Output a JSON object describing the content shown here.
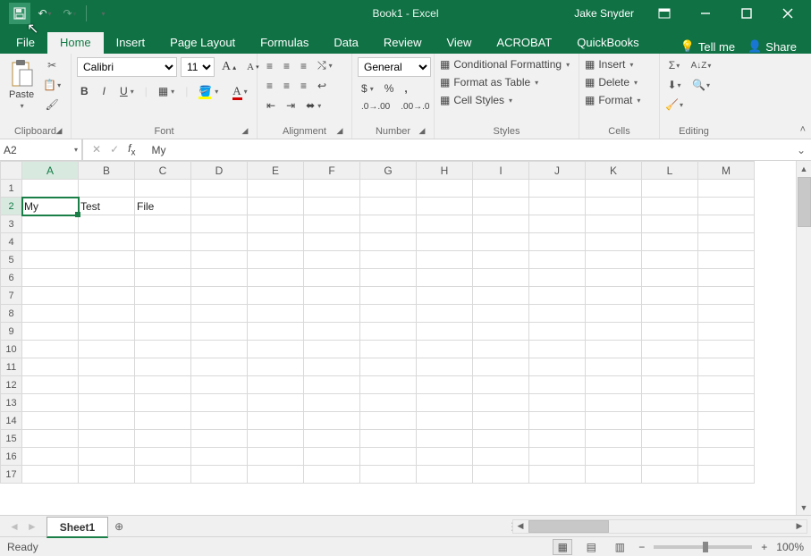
{
  "title": "Book1 - Excel",
  "user": "Jake Snyder",
  "tabs": [
    "File",
    "Home",
    "Insert",
    "Page Layout",
    "Formulas",
    "Data",
    "Review",
    "View",
    "ACROBAT",
    "QuickBooks"
  ],
  "activeTab": "Home",
  "tellMe": "Tell me",
  "share": "Share",
  "groups": {
    "clipboard": "Clipboard",
    "font": "Font",
    "alignment": "Alignment",
    "number": "Number",
    "styles": "Styles",
    "cells": "Cells",
    "editing": "Editing"
  },
  "paste": "Paste",
  "fontName": "Calibri",
  "fontSize": "11",
  "numberFormat": "General",
  "styleItems": {
    "cond": "Conditional Formatting",
    "table": "Format as Table",
    "cell": "Cell Styles"
  },
  "cellItems": {
    "insert": "Insert",
    "delete": "Delete",
    "format": "Format"
  },
  "nameBox": "A2",
  "formula": "My",
  "columns": [
    "A",
    "B",
    "C",
    "D",
    "E",
    "F",
    "G",
    "H",
    "I",
    "J",
    "K",
    "L",
    "M"
  ],
  "rows": 17,
  "selected": {
    "row": 2,
    "col": "A"
  },
  "cells": {
    "A2": "My",
    "B2": "Test",
    "C2": "File"
  },
  "sheetTab": "Sheet1",
  "status": "Ready",
  "zoom": "100%"
}
